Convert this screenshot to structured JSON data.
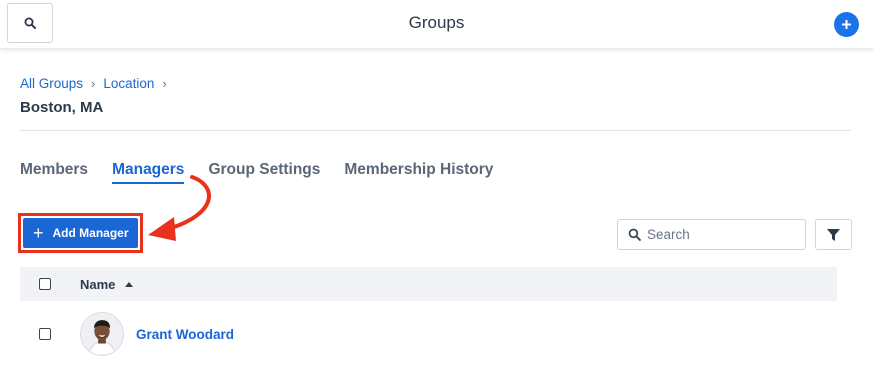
{
  "header": {
    "title": "Groups",
    "search_icon": "search-icon",
    "add_icon": "plus-circle-icon",
    "accent_color": "#1a73e8"
  },
  "breadcrumb": {
    "items": [
      "All Groups",
      "Location"
    ],
    "separator": "›"
  },
  "group": {
    "name": "Boston, MA"
  },
  "tabs": [
    {
      "label": "Members",
      "active": false
    },
    {
      "label": "Managers",
      "active": true
    },
    {
      "label": "Group Settings",
      "active": false
    },
    {
      "label": "Membership History",
      "active": false
    }
  ],
  "toolbar": {
    "add_manager_label": "Add Manager",
    "add_manager_icon": "plus-icon",
    "search_placeholder": "Search",
    "filter_icon": "filter-icon",
    "highlight_color": "#e8321c"
  },
  "table": {
    "columns": [
      {
        "label": "Name",
        "sort": "ascending"
      }
    ],
    "rows": [
      {
        "name": "Grant Woodard",
        "avatar_icon": "avatar"
      }
    ]
  }
}
